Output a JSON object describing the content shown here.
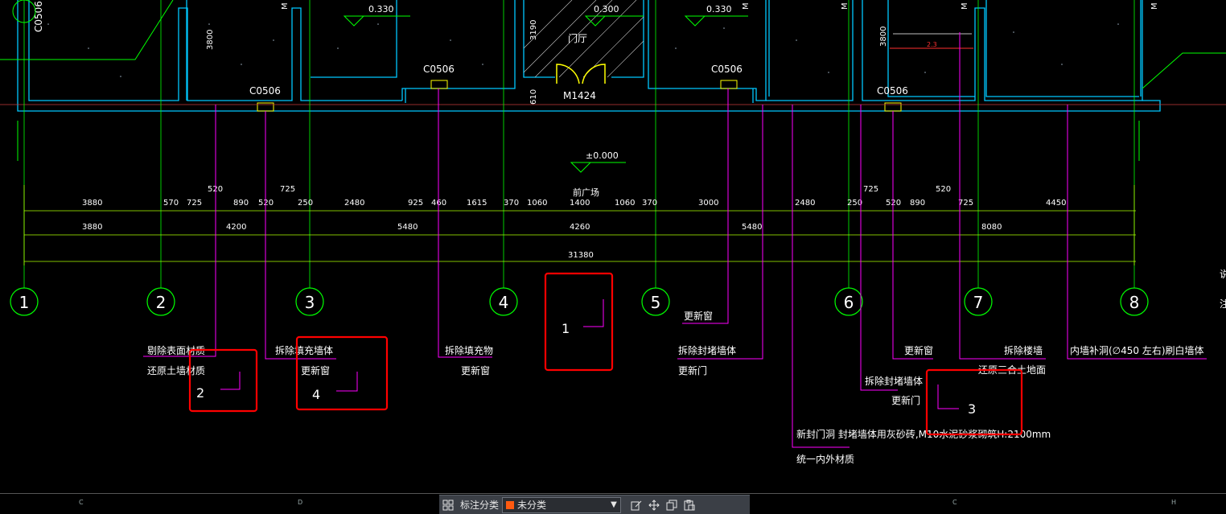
{
  "levels": {
    "entry_hall_dim": "0.330",
    "hall_dim": "0.300",
    "ground_level": "±0.000"
  },
  "labels": {
    "hall": "门厅",
    "front_square": "前广场",
    "door_tag": "M1424",
    "window_tag": "C0506",
    "h3800": "3800",
    "h3190": "3190",
    "h610": "610",
    "room_dim": "2.3",
    "side_tag": "M"
  },
  "dim_rows": {
    "row1": [
      "3880",
      "570",
      "725",
      "890",
      "520",
      "250",
      "2480",
      "925",
      "460",
      "1615",
      "370",
      "1060",
      "1400",
      "1060",
      "370",
      "3000",
      "2480",
      "250",
      "520",
      "890",
      "725",
      "4450"
    ],
    "row1_top": [
      "520",
      "725",
      "725",
      "520"
    ],
    "row2": [
      "3880",
      "4200",
      "5480",
      "4260",
      "5480",
      "8080"
    ],
    "total": "31380"
  },
  "axes": [
    "1",
    "2",
    "3",
    "4",
    "5",
    "6",
    "7",
    "8"
  ],
  "annotations": {
    "a1": "剔除表面材质",
    "a2": "还原土墙材质",
    "a3": "拆除填充墙体",
    "a4": "更新窗",
    "a5": "拆除填充物",
    "a6": "更新窗",
    "a7": "更新窗",
    "a8": "拆除封堵墙体",
    "a9": "更新门",
    "a10": "更新窗",
    "a11": "拆除楼墙",
    "a12": "还原三合土地面",
    "a13": "内墙补洞(∅450 左右)刷白墙体",
    "a14": "拆除封堵墙体",
    "a15": "更新门",
    "a16": "新封门洞 封堵墙体用灰砂砖,M10水泥砂浆砌筑H:2100mm",
    "a17": "统一内外材质"
  },
  "markers": [
    "1",
    "2",
    "3",
    "4"
  ],
  "toolbar": {
    "label": "标注分类",
    "select_value": "未分类"
  },
  "sheet_cols": [
    "C",
    "D",
    "C",
    "H"
  ],
  "colors": {
    "axis": "#00ff00",
    "wall": "#00c8ff",
    "leader": "#ff00ff",
    "highlight": "#ff0000",
    "dimension": "#aaff00",
    "door": "#ffff00"
  }
}
